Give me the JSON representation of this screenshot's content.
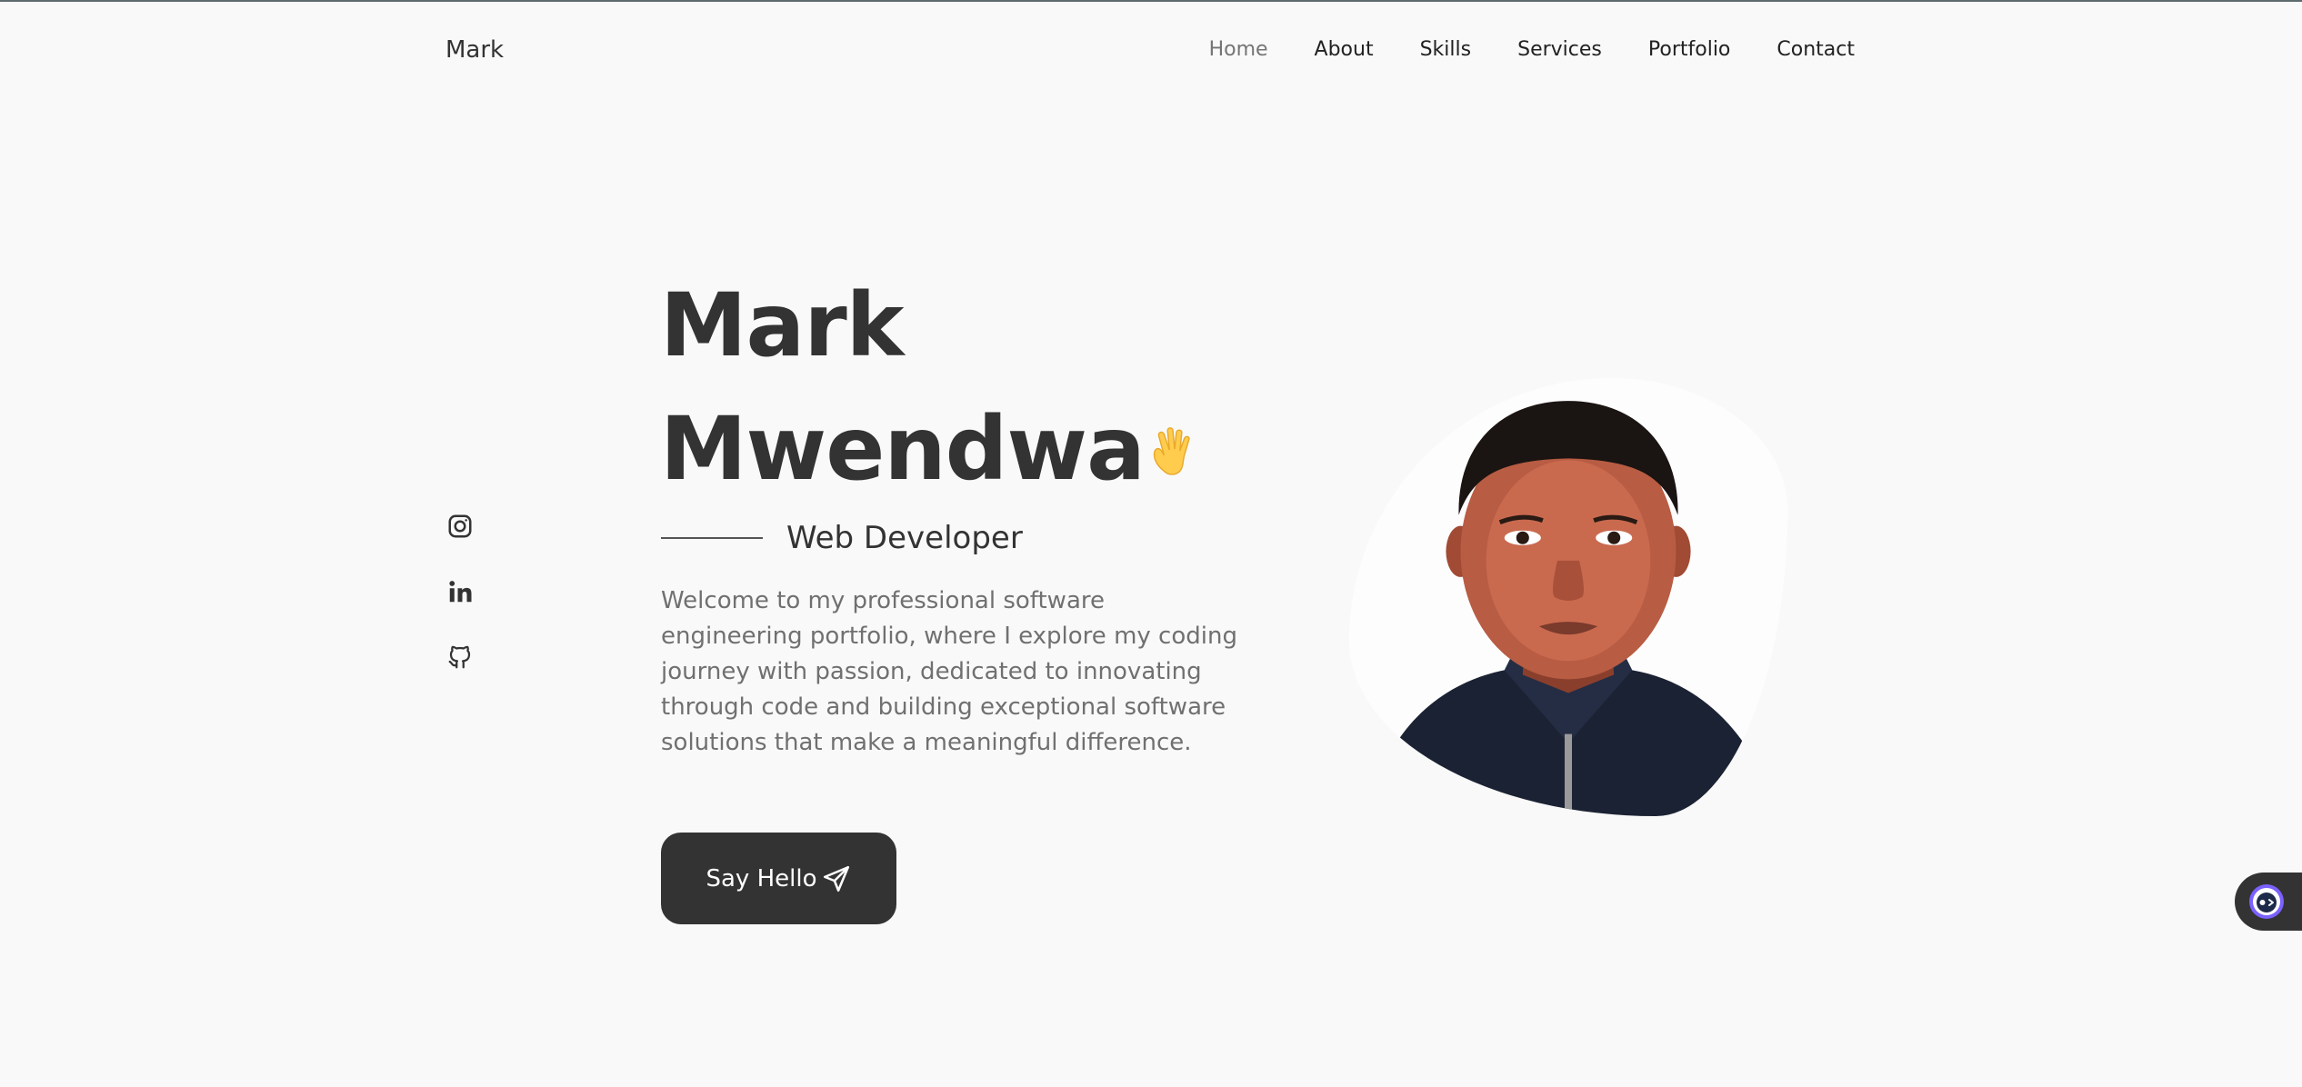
{
  "header": {
    "logo": "Mark",
    "nav": [
      {
        "label": "Home",
        "active": true
      },
      {
        "label": "About"
      },
      {
        "label": "Skills"
      },
      {
        "label": "Services"
      },
      {
        "label": "Portfolio"
      },
      {
        "label": "Contact"
      }
    ]
  },
  "social": [
    {
      "icon": "instagram-icon"
    },
    {
      "icon": "linkedin-icon"
    },
    {
      "icon": "github-icon"
    }
  ],
  "hero": {
    "first_name": "Mark",
    "last_name": "Mwendwa",
    "wave_icon": "waving-hand-icon",
    "subtitle": "Web Developer",
    "description": "Welcome to my professional software engineering portfolio, where I explore my coding journey with passion, dedicated to innovating through code and building exceptional software solutions that make a meaningful difference.",
    "button_label": "Say Hello",
    "button_icon": "send-icon"
  },
  "colors": {
    "background": "#f9f9f9",
    "text": "#333333",
    "muted": "#707070",
    "button": "#333333"
  }
}
